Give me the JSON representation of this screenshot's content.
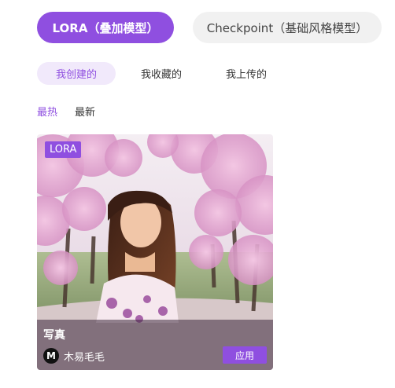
{
  "model_tabs": [
    {
      "label": "LORA（叠加模型）",
      "active": true
    },
    {
      "label": "Checkpoint（基础风格模型）",
      "active": false
    }
  ],
  "sub_tabs": [
    {
      "label": "我创建的",
      "active": true
    },
    {
      "label": "我收藏的",
      "active": false
    },
    {
      "label": "我上传的",
      "active": false
    }
  ],
  "sort_tabs": [
    {
      "label": "最热",
      "active": true
    },
    {
      "label": "最新",
      "active": false
    }
  ],
  "cards": [
    {
      "badge": "LORA",
      "title": "写真",
      "author_initial": "M",
      "author_name": "木易毛毛",
      "action_label": "应用"
    }
  ],
  "colors": {
    "accent": "#8f4fe0",
    "accent_light": "#f1e9fb",
    "inactive_tab": "#f1f1f1"
  }
}
